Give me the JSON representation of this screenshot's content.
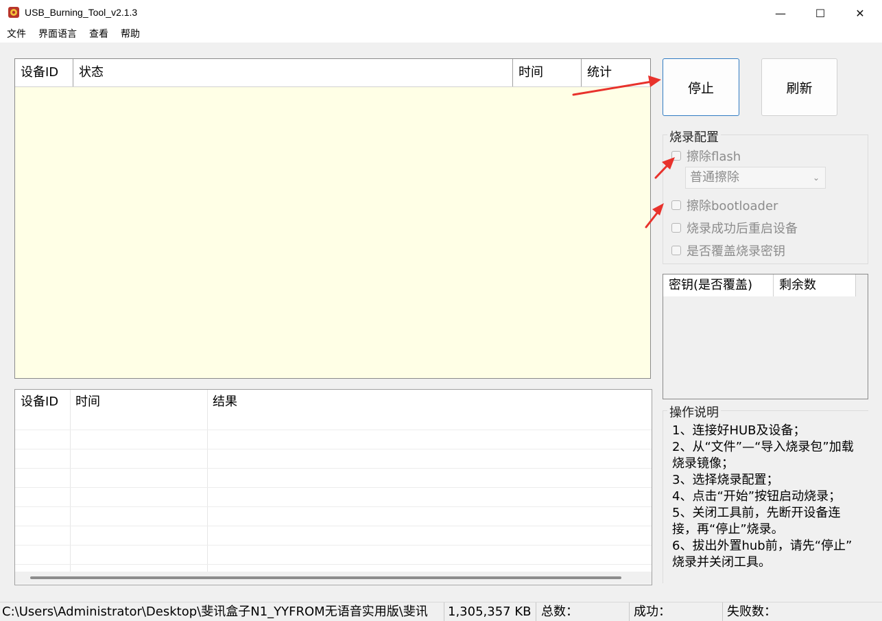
{
  "window": {
    "title": "USB_Burning_Tool_v2.1.3",
    "minimize": "—",
    "maximize": "☐",
    "close": "✕"
  },
  "menu": [
    "文件",
    "界面语言",
    "查看",
    "帮助"
  ],
  "device_table": {
    "columns": [
      "设备ID",
      "状态",
      "时间",
      "统计"
    ],
    "background": "#ffffe6"
  },
  "buttons": {
    "stop": "停止",
    "refresh": "刷新"
  },
  "burn_config": {
    "title": "烧录配置",
    "erase_flash": "擦除flash",
    "erase_mode": "普通擦除",
    "erase_bootloader": "擦除bootloader",
    "reboot_after": "烧录成功后重启设备",
    "overwrite_key": "是否覆盖烧录密钥"
  },
  "key_table": {
    "columns": [
      "密钥(是否覆盖)",
      "剩余数"
    ]
  },
  "log_table": {
    "columns": [
      "设备ID",
      "时间",
      "结果"
    ]
  },
  "instructions": {
    "title": "操作说明",
    "lines": [
      "1、连接好HUB及设备；",
      "2、从“文件”—“导入烧录包”加载",
      "烧录镜像；",
      "3、选择烧录配置；",
      "4、点击“开始”按钮启动烧录；",
      "5、关闭工具前，先断开设备连",
      "接，再“停止”烧录。",
      "6、拔出外置hub前，请先“停止”",
      "烧录并关闭工具。"
    ]
  },
  "status": {
    "path": "C:\\Users\\Administrator\\Desktop\\斐讯盒子N1_YYFROM无语音实用版\\斐讯",
    "size": "1,305,357 KB",
    "total": "总数：",
    "success": "成功：",
    "fail": "失败数："
  },
  "colors": {
    "accent": "#2f7bc2",
    "arrow": "#e8322c"
  }
}
